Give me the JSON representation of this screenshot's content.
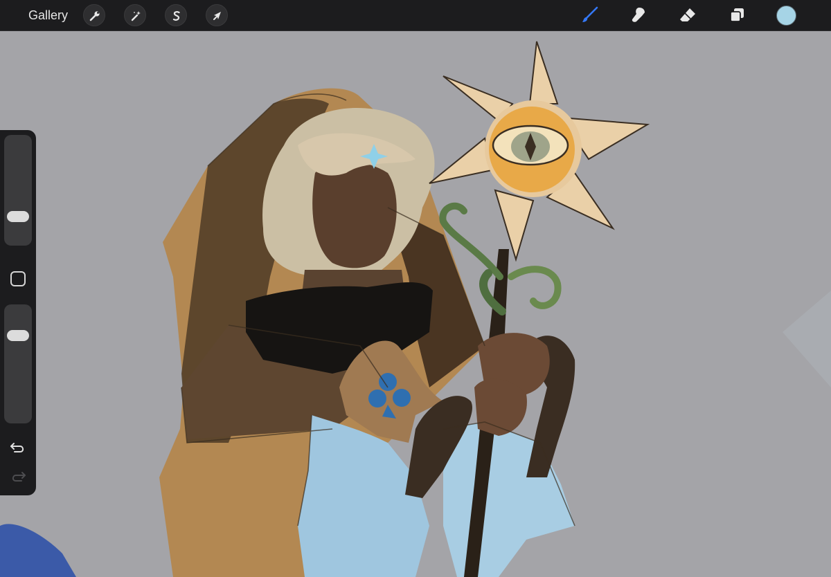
{
  "toolbar": {
    "gallery_label": "Gallery",
    "left_tools": [
      {
        "name": "actions",
        "icon": "wrench-icon"
      },
      {
        "name": "adjustments",
        "icon": "magic-wand-icon"
      },
      {
        "name": "selection",
        "icon": "selection-s-icon"
      },
      {
        "name": "transform",
        "icon": "arrow-cursor-icon"
      }
    ],
    "right_tools": [
      {
        "name": "brush",
        "icon": "brush-icon",
        "active": true
      },
      {
        "name": "smudge",
        "icon": "smudge-finger-icon",
        "active": false
      },
      {
        "name": "eraser",
        "icon": "eraser-icon",
        "active": false
      },
      {
        "name": "layers",
        "icon": "layers-icon",
        "active": false
      }
    ],
    "active_color": "#a6d4e6",
    "active_tool_color": "#3478f6"
  },
  "sidebar": {
    "brush_size_level": 0.22,
    "opacity_level": 0.78,
    "modify_button": "square-icon",
    "undo": "undo-icon",
    "redo": "redo-icon"
  }
}
